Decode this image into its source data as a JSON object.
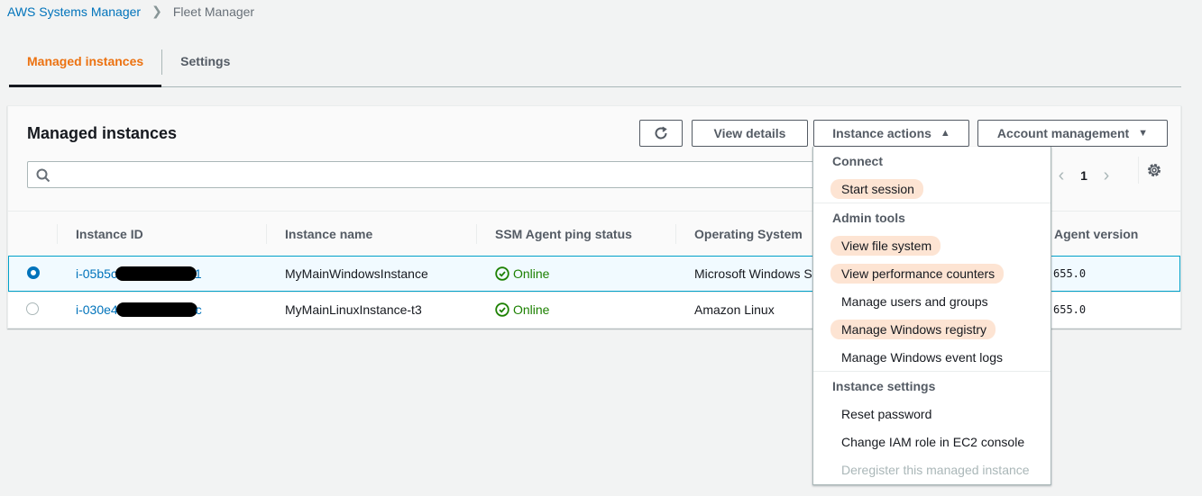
{
  "breadcrumb": {
    "parent": "AWS Systems Manager",
    "current": "Fleet Manager"
  },
  "tabs": [
    {
      "label": "Managed instances",
      "active": true
    },
    {
      "label": "Settings",
      "active": false
    }
  ],
  "panel": {
    "title": "Managed instances",
    "buttons": {
      "refresh_icon": "refresh-icon",
      "view_details": "View details",
      "instance_actions": "Instance actions",
      "account_management": "Account management"
    },
    "search": {
      "placeholder": "",
      "value": ""
    },
    "pagination": {
      "current_page": "1"
    }
  },
  "table": {
    "columns": [
      "Instance ID",
      "Instance name",
      "SSM Agent ping status",
      "Operating System",
      "Agent version"
    ],
    "rows": [
      {
        "selected": true,
        "id_prefix": "i-05b5c",
        "id_suffix": "1",
        "name": "MyMainWindowsInstance",
        "status": "Online",
        "os": "Microsoft Windows S",
        "agent_version": "655.0"
      },
      {
        "selected": false,
        "id_prefix": "i-030e4",
        "id_suffix": "c",
        "name": "MyMainLinuxInstance-t3",
        "status": "Online",
        "os": "Amazon Linux",
        "agent_version": "655.0"
      }
    ]
  },
  "instance_actions_menu": {
    "groups": [
      {
        "heading": "Connect",
        "items": [
          {
            "label": "Start session",
            "highlighted": true,
            "disabled": false
          }
        ]
      },
      {
        "heading": "Admin tools",
        "items": [
          {
            "label": "View file system",
            "highlighted": true,
            "disabled": false
          },
          {
            "label": "View performance counters",
            "highlighted": true,
            "disabled": false
          },
          {
            "label": "Manage users and groups",
            "highlighted": false,
            "disabled": false
          },
          {
            "label": "Manage Windows registry",
            "highlighted": true,
            "disabled": false
          },
          {
            "label": "Manage Windows event logs",
            "highlighted": false,
            "disabled": false
          }
        ]
      },
      {
        "heading": "Instance settings",
        "items": [
          {
            "label": "Reset password",
            "highlighted": false,
            "disabled": false
          },
          {
            "label": "Change IAM role in EC2 console",
            "highlighted": false,
            "disabled": false
          },
          {
            "label": "Deregister this managed instance",
            "highlighted": false,
            "disabled": true
          }
        ]
      }
    ]
  },
  "colors": {
    "accent_orange": "#ec7211",
    "link_blue": "#0073bb",
    "online_green": "#1d8102",
    "highlight": "#fde4d3"
  }
}
